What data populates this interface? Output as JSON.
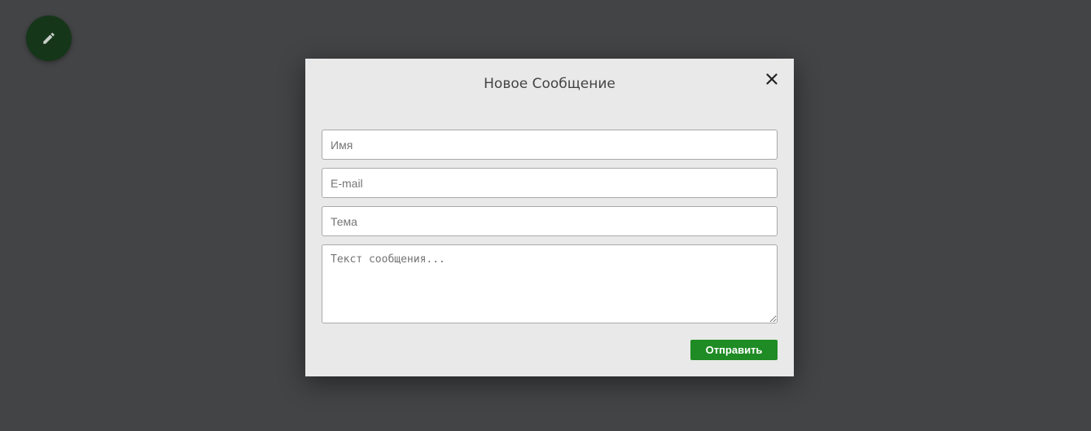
{
  "fab": {
    "icon": "pencil-icon",
    "color": "#16361a"
  },
  "modal": {
    "title": "Новое Сообщение",
    "close_icon": "close-icon",
    "fields": {
      "name_placeholder": "Имя",
      "email_placeholder": "E-mail",
      "subject_placeholder": "Тема",
      "message_placeholder": "Текст сообщения..."
    },
    "submit_label": "Отправить",
    "submit_color": "#1f8b24"
  },
  "colors": {
    "backdrop": "#434446",
    "modal_bg": "#e8e9e8"
  }
}
